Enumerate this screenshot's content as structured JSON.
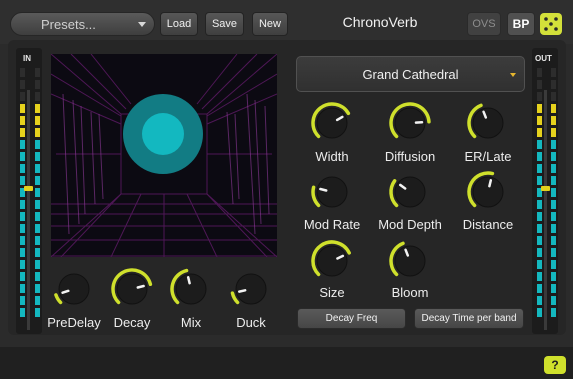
{
  "header": {
    "presets_label": "Presets...",
    "load_label": "Load",
    "save_label": "Save",
    "new_label": "New",
    "title": "ChronoVerb",
    "ovs_label": "OVS",
    "bp_label": "BP"
  },
  "meters": {
    "in_label": "IN",
    "out_label": "OUT"
  },
  "preset_select": {
    "value": "Grand Cathedral"
  },
  "knobs": {
    "width": {
      "label": "Width",
      "value": 0.72
    },
    "diffusion": {
      "label": "Diffusion",
      "value": 0.82
    },
    "er_late": {
      "label": "ER/Late",
      "value": 0.42
    },
    "mod_rate": {
      "label": "Mod Rate",
      "value": 0.22
    },
    "mod_depth": {
      "label": "Mod Depth",
      "value": 0.3
    },
    "distance": {
      "label": "Distance",
      "value": 0.55
    },
    "size": {
      "label": "Size",
      "value": 0.74
    },
    "bloom": {
      "label": "Bloom",
      "value": 0.42
    },
    "predelay": {
      "label": "PreDelay",
      "value": 0.1
    },
    "decay": {
      "label": "Decay",
      "value": 0.78
    },
    "mix": {
      "label": "Mix",
      "value": 0.45
    },
    "duck": {
      "label": "Duck",
      "value": 0.12
    }
  },
  "buttons": {
    "decay_freq": "Decay Freq",
    "decay_time_per_band": "Decay Time per band"
  },
  "help_label": "?",
  "colors": {
    "accent": "#cfe02c",
    "orb_outer": "#127c84",
    "orb_inner": "#13b8c0",
    "meter_teal": "#14b8bf",
    "meter_yellow": "#e6d21d",
    "grid_magenta": "#6a1e74"
  }
}
